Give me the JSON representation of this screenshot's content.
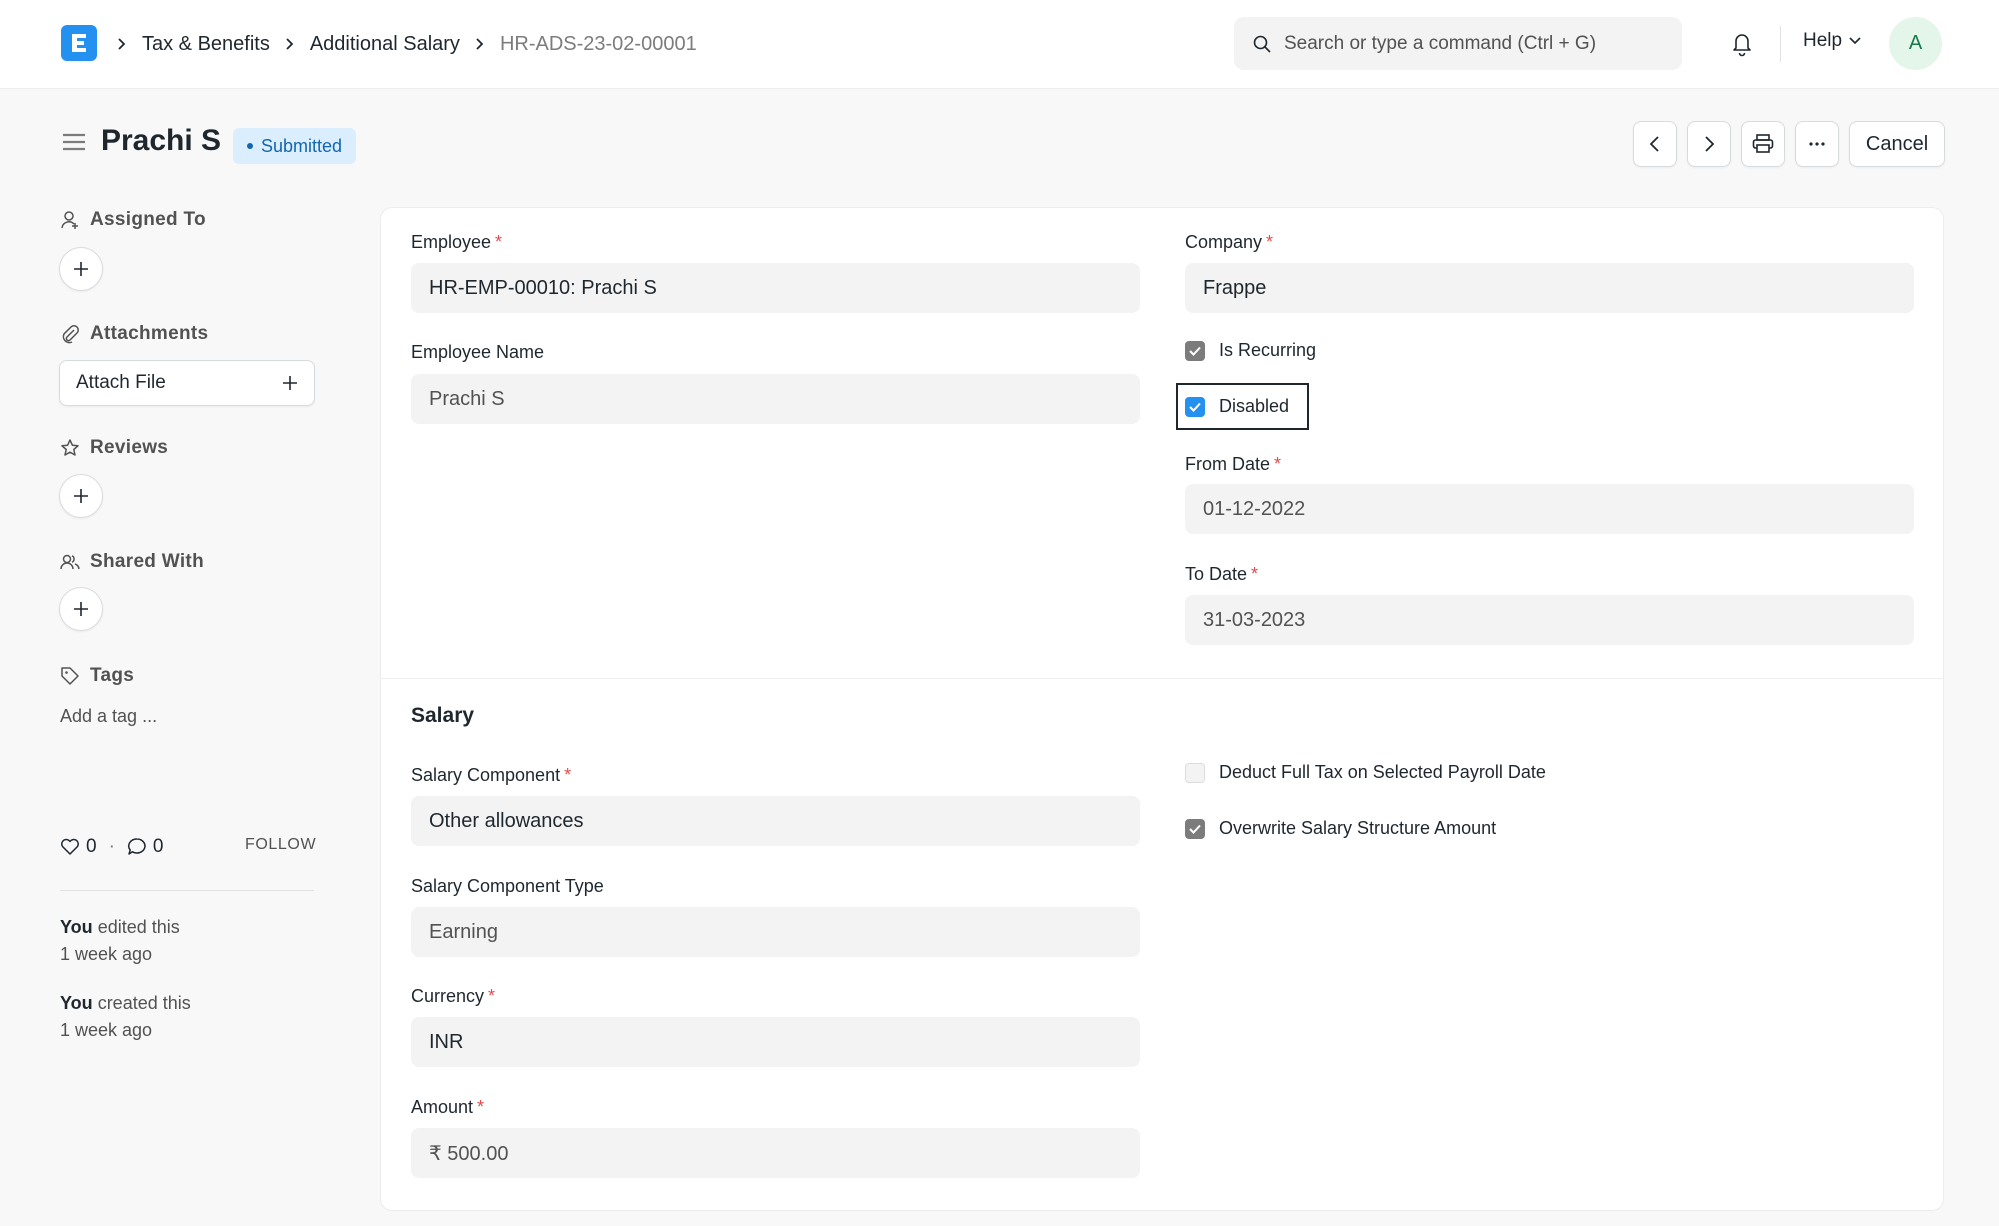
{
  "navbar": {
    "breadcrumbs": [
      "Tax & Benefits",
      "Additional Salary",
      "HR-ADS-23-02-00001"
    ],
    "search_placeholder": "Search or type a command (Ctrl + G)",
    "help_label": "Help",
    "avatar_initial": "A"
  },
  "page": {
    "title": "Prachi S",
    "status": "Submitted",
    "cancel_label": "Cancel"
  },
  "sidebar": {
    "assigned_to": "Assigned To",
    "attachments": "Attachments",
    "attach_file": "Attach File",
    "reviews": "Reviews",
    "shared_with": "Shared With",
    "tags": "Tags",
    "add_tag": "Add a tag ...",
    "likes_count": "0",
    "comments_count": "0",
    "follow": "FOLLOW",
    "activity": [
      {
        "actor": "You",
        "action": "edited this",
        "when": "1 week ago"
      },
      {
        "actor": "You",
        "action": "created this",
        "when": "1 week ago"
      }
    ]
  },
  "form": {
    "employee": {
      "label": "Employee",
      "value": "HR-EMP-00010: Prachi S"
    },
    "employee_name": {
      "label": "Employee Name",
      "value": "Prachi S"
    },
    "company": {
      "label": "Company",
      "value": "Frappe"
    },
    "is_recurring": {
      "label": "Is Recurring",
      "checked": true
    },
    "disabled": {
      "label": "Disabled",
      "checked": true
    },
    "from_date": {
      "label": "From Date",
      "value": "01-12-2022"
    },
    "to_date": {
      "label": "To Date",
      "value": "31-03-2023"
    },
    "salary_section": "Salary",
    "salary_component": {
      "label": "Salary Component",
      "value": "Other allowances"
    },
    "salary_component_type": {
      "label": "Salary Component Type",
      "value": "Earning"
    },
    "currency": {
      "label": "Currency",
      "value": "INR"
    },
    "amount": {
      "label": "Amount",
      "value": "₹ 500.00"
    },
    "deduct_full_tax": {
      "label": "Deduct Full Tax on Selected Payroll Date",
      "checked": false
    },
    "overwrite_salary": {
      "label": "Overwrite Salary Structure Amount",
      "checked": true
    }
  },
  "colors": {
    "brand": "#2490ef",
    "badge_bg": "#dbeefe",
    "badge_text": "#1366ae",
    "required": "#e24c4c"
  }
}
